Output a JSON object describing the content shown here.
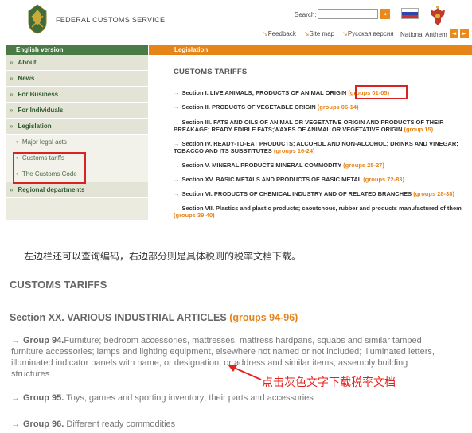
{
  "header": {
    "site_title": "FEDERAL CUSTOMS SERVICE",
    "search_label": "Search:",
    "search_go": "»",
    "links": [
      {
        "label": "Feedback"
      },
      {
        "label": "Site map"
      },
      {
        "label": "Русская версия"
      }
    ],
    "anthem_label": "National Anthem",
    "prev_btn": "◄",
    "next_btn": "►"
  },
  "sidebar": {
    "header": "English version",
    "items": [
      {
        "label": "About"
      },
      {
        "label": "News"
      },
      {
        "label": "For Business"
      },
      {
        "label": "For Individuals"
      },
      {
        "label": "Legislation"
      }
    ],
    "subitems": [
      {
        "label": "Major legal acts"
      },
      {
        "label": "Customs tariffs"
      },
      {
        "label": "The Customs Code"
      }
    ],
    "last_item": "Regional departments"
  },
  "main": {
    "header": "Legislation",
    "title": "CUSTOMS TARIFFS",
    "sections": [
      {
        "text": "Section I. LIVE ANIMALS; PRODUCTS OF ANIMAL ORIGIN ",
        "groups": "(groups 01-05)"
      },
      {
        "text": "Section II. PRODUCTS OF VEGETABLE ORIGIN ",
        "groups": "(groups 06-14)"
      },
      {
        "text": "Section III. FATS AND OILS OF ANIMAL OR VEGETATIVE ORIGIN AND PRODUCTS OF THEIR BREAKAGE; READY EDIBLE FATS;WAXES OF ANIMAL OR VEGETATIVE ORIGIN ",
        "groups": "(group 15)"
      },
      {
        "text": "Section IV. READY-TO-EAT PRODUCTS; ALCOHOL AND NON-ALCOHOL; DRINKS AND VINEGAR; TOBACCO AND ITS SUBSTITUTES ",
        "groups": "(groups 16-24)"
      },
      {
        "text": "Section V. MINERAL PRODUCTS MINERAL COMMODITY ",
        "groups": "(groups 25-27)"
      },
      {
        "text": "Section XV. BASIC METALS AND PRODUCTS OF BASIC METAL ",
        "groups": "(groups 72-83)"
      },
      {
        "text": "Section VI. PRODUCTS OF CHEMICAL INDUSTRY AND OF RELATED BRANCHES ",
        "groups": "(groups 28-38)"
      },
      {
        "text": "Section VII. Plastics and plastic products; caoutchouc, rubber and products manufactured of them ",
        "groups": "(groups 39-40)"
      }
    ]
  },
  "caption": "左边栏还可以查询编码，右边部分则是具体税则的税率文档下载。",
  "zoom": {
    "title": "CUSTOMS TARIFFS",
    "section_text": "Section XX. VARIOUS INDUSTRIAL ARTICLES ",
    "section_groups": "(groups 94-96)",
    "groups": [
      {
        "name": "Group 94.",
        "desc": "Furniture; bedroom accessories, mattresses, mattress hardpans, squabs and similar tamped furniture accessories; lamps and lighting equipment, elsewhere not named or not included; illuminated letters, illuminated indicator panels with name, or designation, or address and similar items; assembly building structures"
      },
      {
        "name": "Group 95.",
        "desc": " Toys, games and sporting inventory; their parts and accessories"
      },
      {
        "name": "Group 96.",
        "desc": " Different ready commodities"
      }
    ],
    "annotation": "点击灰色文字下载税率文档"
  },
  "colors": {
    "accent_orange": "#e68418",
    "sidebar_green": "#4a7a46",
    "highlight_red": "#d72422"
  }
}
